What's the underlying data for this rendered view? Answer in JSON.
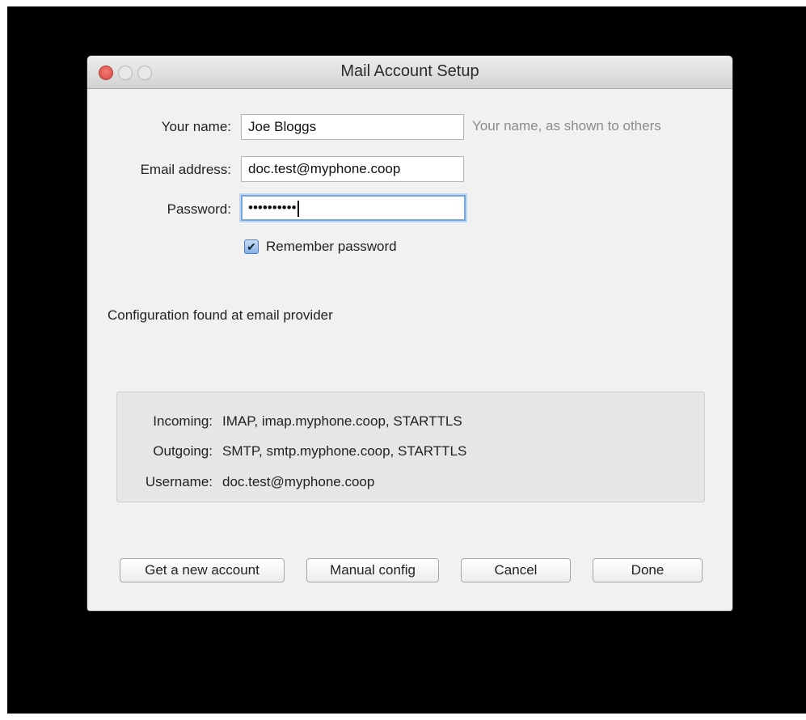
{
  "window": {
    "title": "Mail Account Setup"
  },
  "form": {
    "name_label": "Your name:",
    "name_value": "Joe Bloggs",
    "name_hint": "Your name, as shown to others",
    "email_label": "Email address:",
    "email_value": "doc.test@myphone.coop",
    "password_label": "Password:",
    "password_value": "••••••••••",
    "remember_label": "Remember password",
    "remember_checked": true
  },
  "status": {
    "text": "Configuration found at email provider"
  },
  "config": {
    "rows": [
      {
        "key": "Incoming:",
        "value": "IMAP, imap.myphone.coop, STARTTLS"
      },
      {
        "key": "Outgoing:",
        "value": "SMTP, smtp.myphone.coop, STARTTLS"
      },
      {
        "key": "Username:",
        "value": "doc.test@myphone.coop"
      }
    ]
  },
  "buttons": {
    "new_account": "Get a new account",
    "manual_config": "Manual config",
    "cancel": "Cancel",
    "done": "Done"
  },
  "colors": {
    "close": "#d2483f",
    "focus_ring": "#7aa7de",
    "panel": "#e6e6e6",
    "backdrop": "#000000"
  }
}
